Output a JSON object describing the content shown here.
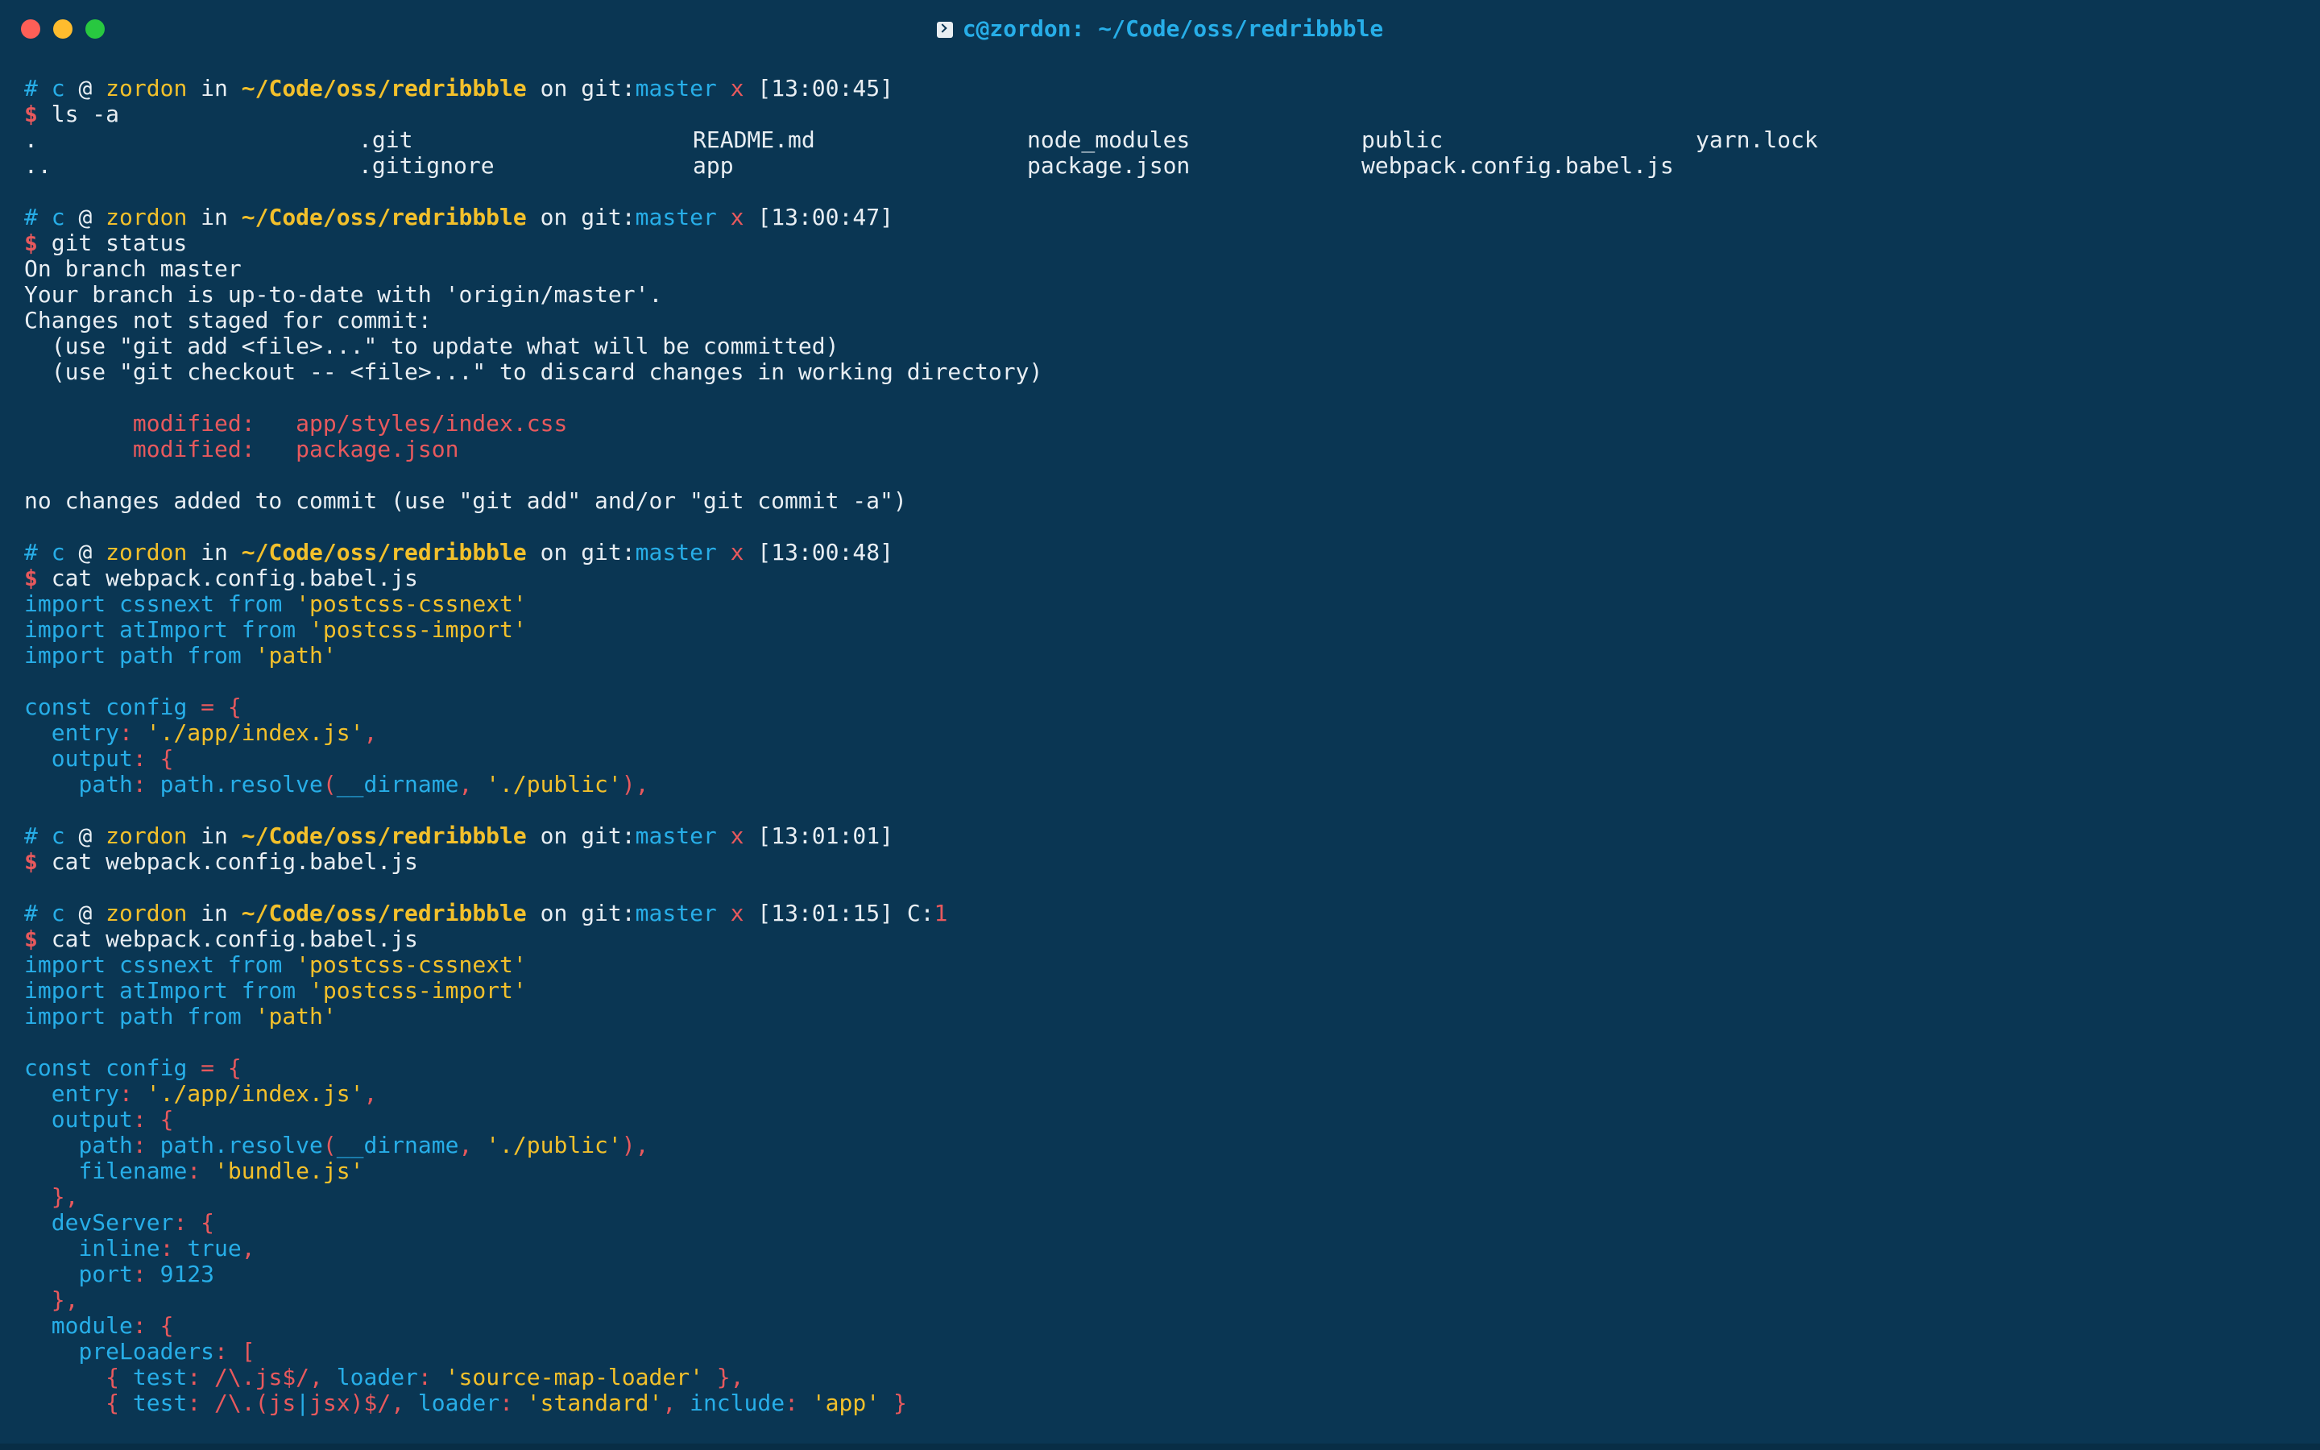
{
  "window": {
    "title": "c@zordon: ~/Code/oss/redribbble"
  },
  "prompt": {
    "hash": "#",
    "user": "c",
    "at": "@",
    "host": "zordon",
    "in": "in",
    "path": "~/Code/oss/redribbble",
    "on": "on",
    "git_label": "git:",
    "branch": "master",
    "dirty": "x",
    "dollar": "$"
  },
  "blocks": [
    {
      "time": "[13:00:45]",
      "command": "ls -a",
      "output": [
        [
          ".",
          ".git",
          "README.md",
          "node_modules",
          "public",
          "yarn.lock"
        ],
        [
          "..",
          ".gitignore",
          "app",
          "package.json",
          "webpack.config.babel.js",
          ""
        ]
      ]
    },
    {
      "time": "[13:00:47]",
      "command": "git status",
      "output_lines": [
        "On branch master",
        "Your branch is up-to-date with 'origin/master'.",
        "Changes not staged for commit:",
        "  (use \"git add <file>...\" to update what will be committed)",
        "  (use \"git checkout -- <file>...\" to discard changes in working directory)"
      ],
      "modified": [
        {
          "label": "modified:",
          "file": "app/styles/index.css"
        },
        {
          "label": "modified:",
          "file": "package.json"
        }
      ],
      "footer": "no changes added to commit (use \"git add\" and/or \"git commit -a\")"
    },
    {
      "time": "[13:00:48]",
      "command": "cat webpack.config.babel.js"
    },
    {
      "time": "[13:01:01]",
      "command": "cat webpack.config.babel.js"
    },
    {
      "time": "[13:01:15]",
      "exit_label": "C:",
      "exit_code": "1",
      "command": "cat webpack.config.babel.js"
    }
  ],
  "code": {
    "import": "import",
    "from": "from",
    "cssnext": "cssnext",
    "cssnext_mod": "'postcss-cssnext'",
    "atImport": "atImport",
    "atImport_mod": "'postcss-import'",
    "path": "path",
    "path_mod": "'path'",
    "const": "const",
    "config": "config",
    "eq": "=",
    "entry": "entry",
    "entry_val": "'./app/index.js'",
    "output": "output",
    "path_key": "path",
    "path_resolve": "path.resolve",
    "dirname": "__dirname",
    "public_val": "'./public'",
    "filename": "filename",
    "bundle": "'bundle.js'",
    "devServer": "devServer",
    "inline": "inline",
    "true_val": "true",
    "port": "port",
    "port_val": "9123",
    "module": "module",
    "preLoaders": "preLoaders",
    "test": "test",
    "re_js": "/\\.js$/",
    "loader": "loader",
    "smloader": "'source-map-loader'",
    "re_jsx_a": "/\\.(js",
    "re_pipe": "|",
    "re_jsx_b": "jsx)$/",
    "standard": "'standard'",
    "include": "include",
    "app_val": "'app'"
  },
  "colors": {
    "background": "#0a3653",
    "blue": "#27aee8",
    "yellow": "#f3c02b",
    "red": "#e8595d",
    "text": "#e8eef3"
  }
}
